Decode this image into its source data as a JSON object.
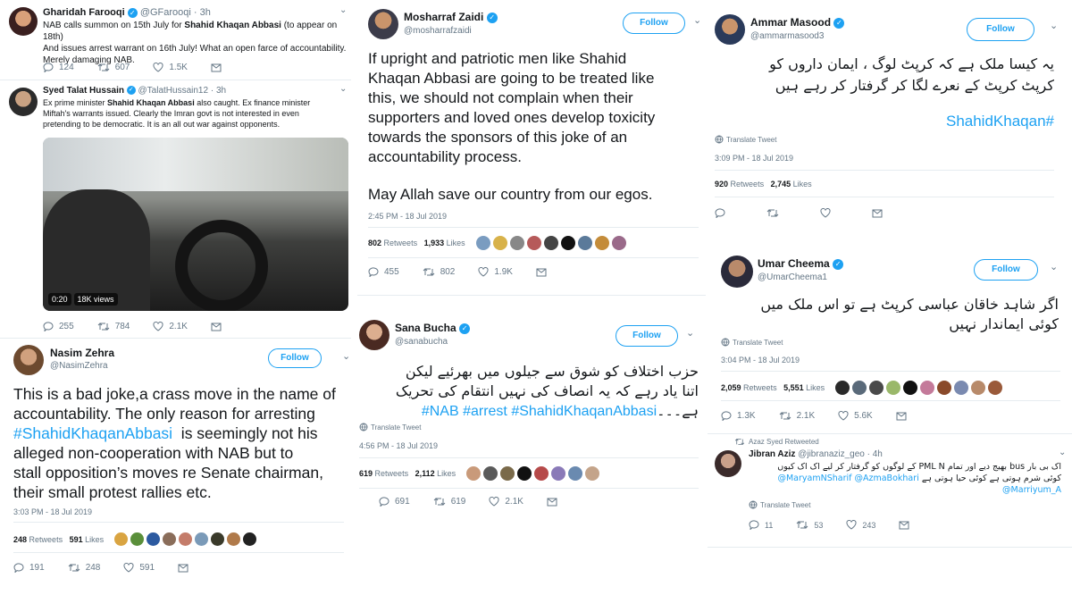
{
  "common": {
    "follow": "Follow",
    "translate": "Translate Tweet",
    "retweets": "Retweets",
    "likes": "Likes",
    "dot": "·"
  },
  "t1": {
    "name": "Gharidah Farooqi",
    "handle": "@GFarooqi",
    "time": "3h",
    "text_a": "NAB calls summon on 15th July for ",
    "text_b": "Shahid Khaqan Abbasi",
    "text_c": " (to appear on 18th)",
    "text_2": "And issues arrest warrant on 16th July! What an open farce of accountability.",
    "text_3": "Merely damaging NAB.",
    "replies": "124",
    "retweets": "607",
    "likes": "1.5K"
  },
  "t2": {
    "name": "Syed Talat Hussain",
    "handle": "@TalatHussain12",
    "time": "3h",
    "text_1a": "Ex prime minister ",
    "text_1b": "Shahid Khaqan Abbasi",
    "text_1c": " also caught. Ex finance minister",
    "text_2": "Miftah's warrants issued. Clearly the Imran govt is not interested in even",
    "text_3": "pretending to be democratic. It is an all out war against opponents.",
    "video_time": "0:20",
    "video_views": "18K views",
    "replies": "255",
    "retweets": "784",
    "likes": "2.1K"
  },
  "t3": {
    "name": "Nasim Zehra",
    "handle": "@NasimZehra",
    "line1": "This is a bad joke,a crass move in the name of",
    "line2": "accountability. The only reason for arresting",
    "hashtag": "#ShahidKhaqanAbbasi",
    "line3": "  is seemingly not his",
    "line4": "alleged non-cooperation with NAB but to",
    "line5": "stall opposition’s moves re Senate chairman,",
    "line6": "their small protest rallies etc.",
    "date": "3:03 PM - 18 Jul 2019",
    "retweets": "248",
    "likes": "591",
    "replies": "191",
    "rt_count": "248",
    "like_count": "591"
  },
  "t4": {
    "name": "Mosharraf Zaidi",
    "handle": "@mosharrafzaidi",
    "line1": "If upright and patriotic men like Shahid",
    "line2": "Khaqan Abbasi are going to be treated like",
    "line3": "this, we should not complain when their",
    "line4": "supporters and loved ones develop toxicity",
    "line5": "towards the sponsors of this joke of an",
    "line6": "accountability process.",
    "line7": "May Allah save our country from our egos.",
    "date": "2:45 PM - 18 Jul 2019",
    "retweets": "802",
    "likes": "1,933",
    "replies": "455",
    "rt_count": "802",
    "like_count": "1.9K"
  },
  "t5": {
    "name": "Sana Bucha",
    "handle": "@sanabucha",
    "line1": "حزب اختلاف کو شوق سے جیلوں میں بھرئیے لیکن",
    "line2": "اتنا یاد رہے کہ یہ انصاف کی نہیں انتقام کی تحریک",
    "line3_urdu": "ہے۔۔۔",
    "line3_tags": "#NAB #arrest #ShahidKhaqanAbbasi",
    "date": "4:56 PM - 18 Jul 2019",
    "retweets": "619",
    "likes": "2,112",
    "replies": "691",
    "rt_count": "619",
    "like_count": "2.1K"
  },
  "t6": {
    "name": "Ammar Masood",
    "handle": "@ammarmasood3",
    "line1": "یہ کیسا ملک ہے کہ کرپٹ لوگ ، ایمان داروں کو",
    "line2": "کرپٹ کرپٹ کے نعرے لگا کر گرفتار کر رہے ہیں",
    "hashtag": "#ShahidKhaqan",
    "date": "3:09 PM - 18 Jul 2019",
    "retweets": "920",
    "likes": "2,745"
  },
  "t7": {
    "name": "Umar Cheema",
    "handle": "@UmarCheema1",
    "line1": "اگر شاہد خاقان عباسی کرپٹ ہے تو اس ملک میں",
    "line2": "کوئی ایماندار نہیں",
    "date": "3:04 PM - 18 Jul 2019",
    "retweets": "2,059",
    "likes": "5,551",
    "replies": "1.3K",
    "rt_count": "2.1K",
    "like_count": "5.6K"
  },
  "t8": {
    "retweeted_by": "Azaz Syed Retweeted",
    "name": "Jibran Aziz",
    "handle": "@jibranaziz_geo",
    "time": "4h",
    "line1": "اک بی بار bus بھیج دیے اور تمام PML N کے لوگوں کو گرفتار کر لیے اک اک کیوں",
    "line2_urdu": "کوئی شرم ہوتی ہے کوئی حیا ہوتی ہے",
    "mention1": "@MaryamNSharif",
    "mention2": "@AzmaBokhari",
    "mention3": "@Marriyum_A",
    "replies": "11",
    "retweets": "53",
    "likes": "243"
  }
}
